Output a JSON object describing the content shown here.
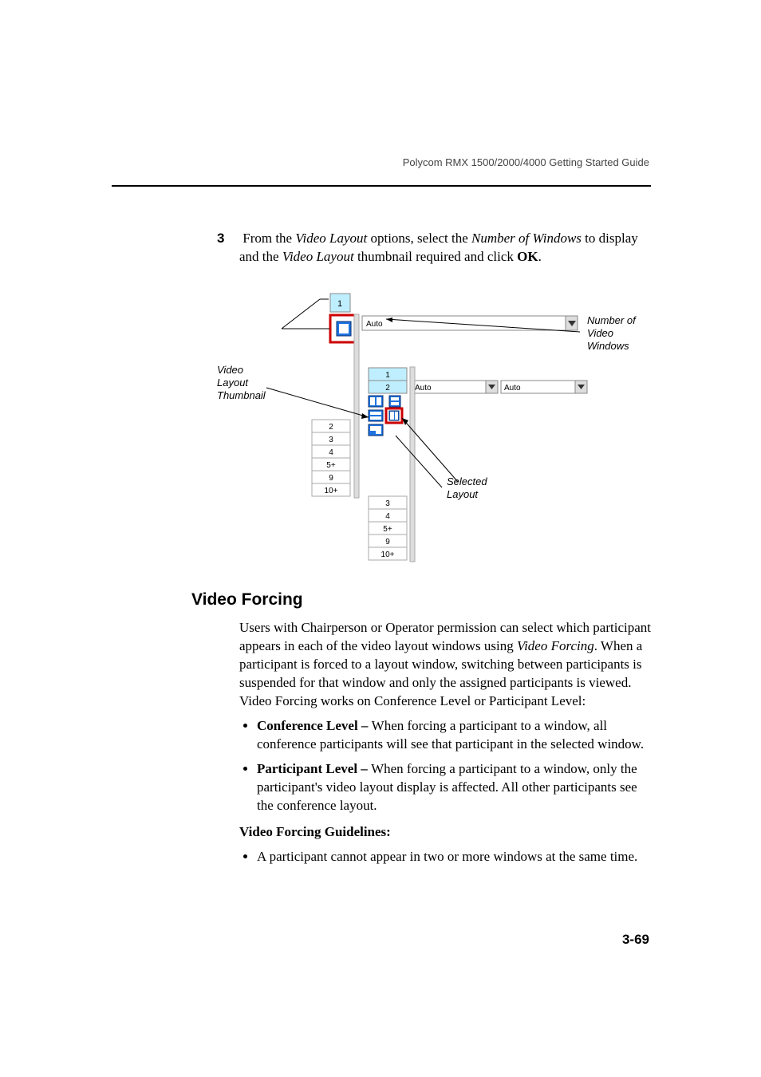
{
  "header": "Polycom RMX 1500/2000/4000 Getting Started Guide",
  "step": {
    "number": "3",
    "text_a": "From the ",
    "text_b": "Video Layout",
    "text_c": " options, select the ",
    "text_d": "Number of Windows",
    "text_e": " to display and the ",
    "text_f": "Video Layout",
    "text_g": " thumbnail required and click ",
    "text_h": "OK",
    "text_i": "."
  },
  "figure": {
    "annotation_thumbnail_l1": "Video",
    "annotation_thumbnail_l2": "Layout",
    "annotation_thumbnail_l3": "Thumbnail",
    "annotation_windows_l1": "Number of",
    "annotation_windows_l2": "Video",
    "annotation_windows_l3": "Windows",
    "annotation_selected_l1": "Selected",
    "annotation_selected_l2": "Layout",
    "dropdown_auto": "Auto",
    "menu_items_left": [
      "1",
      "2",
      "3",
      "4",
      "5+",
      "9",
      "10+"
    ],
    "menu_items_right": [
      "1",
      "2",
      "3",
      "4",
      "5+",
      "9",
      "10+"
    ]
  },
  "section_heading": "Video Forcing",
  "para1_a": "Users with Chairperson or Operator permission can select which participant appears in each of the video layout windows using ",
  "para1_b": "Video Forcing",
  "para1_c": ". When a participant is forced to a layout window, switching between participants is suspended for that window and only the assigned participants is viewed. Video Forcing works on Conference Level or Participant Level:",
  "bullet1_label": "Conference Level – ",
  "bullet1_text": "When forcing a participant to a window, all conference participants will see that participant in the selected window.",
  "bullet2_label": "Participant Level – ",
  "bullet2_text": "When forcing a participant to a window, only the participant's video layout display is affected. All other participants see the conference layout.",
  "guidelines_heading": "Video Forcing Guidelines:",
  "bullet3_text": "A participant cannot appear in two or more windows at the same time.",
  "page_number": "3-69"
}
